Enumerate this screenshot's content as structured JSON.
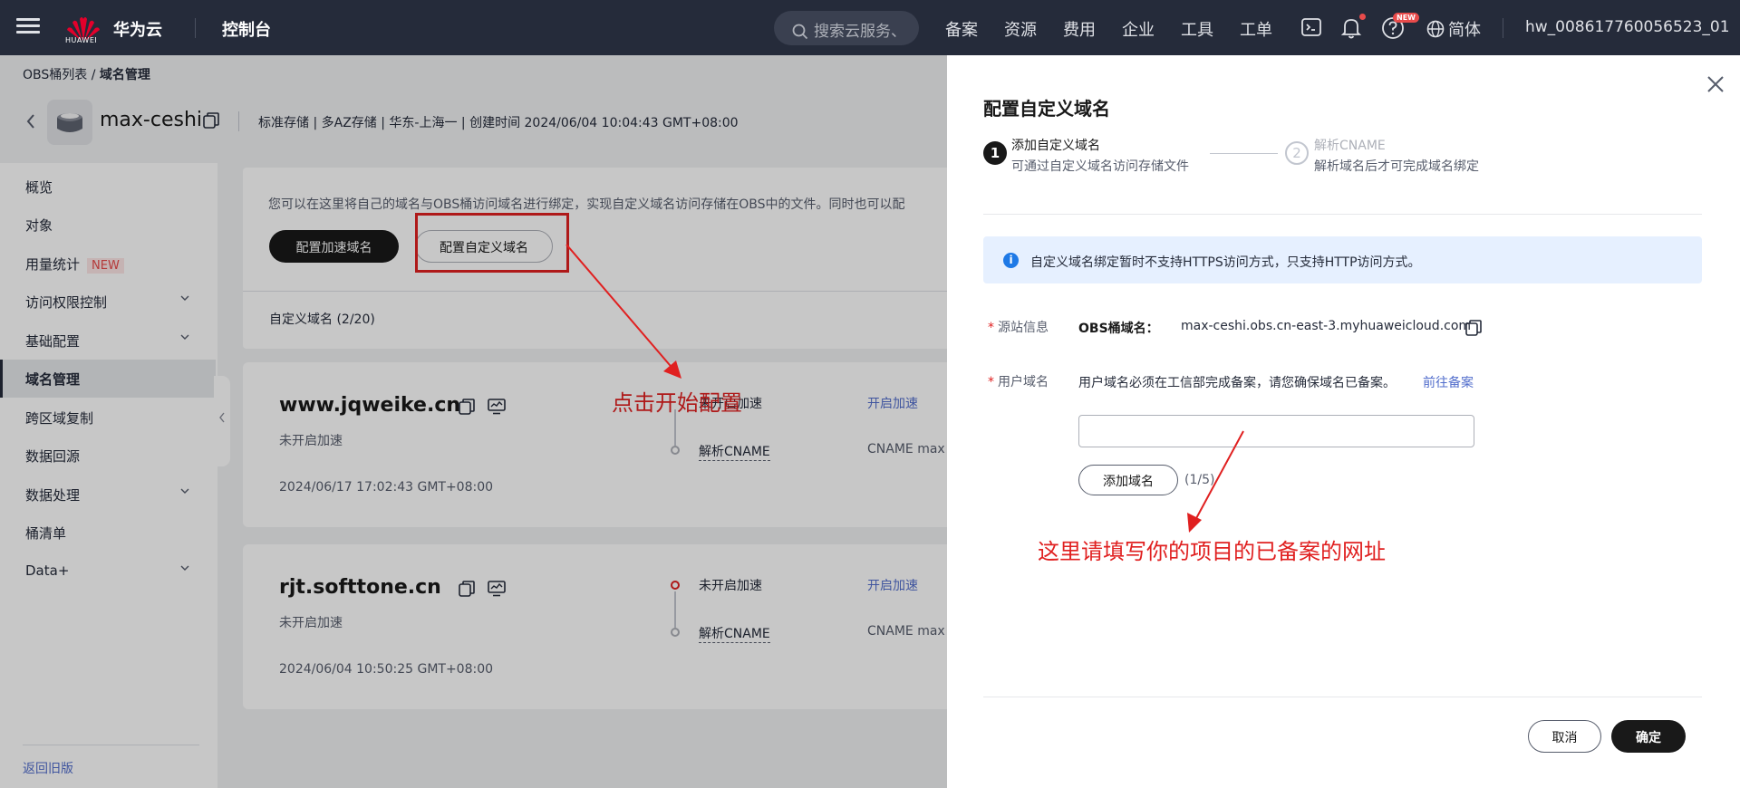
{
  "topbar": {
    "logo_text": "HUAWEI",
    "brand": "华为云",
    "console": "控制台",
    "search_placeholder": "搜索云服务、",
    "nav": [
      "备案",
      "资源",
      "费用",
      "企业",
      "工具",
      "工单"
    ],
    "new_badge": "NEW",
    "language": "简体",
    "user": "hw_008617760056523_01"
  },
  "breadcrumb": {
    "parent": "OBS桶列表",
    "current": "域名管理"
  },
  "bucket": {
    "name": "max-ceshi",
    "meta": "标准存储 | 多AZ存储 | 华东-上海一 | 创建时间  2024/06/04 10:04:43 GMT+08:00"
  },
  "sidebar": {
    "items": [
      {
        "label": "概览",
        "chev": false
      },
      {
        "label": "对象",
        "chev": false
      },
      {
        "label": "用量统计",
        "chev": false,
        "tag": "NEW"
      },
      {
        "label": "访问权限控制",
        "chev": true
      },
      {
        "label": "基础配置",
        "chev": true
      },
      {
        "label": "域名管理",
        "chev": false,
        "active": true
      },
      {
        "label": "跨区域复制",
        "chev": false
      },
      {
        "label": "数据回源",
        "chev": false
      },
      {
        "label": "数据处理",
        "chev": true
      },
      {
        "label": "桶清单",
        "chev": false
      },
      {
        "label": "Data+",
        "chev": true
      }
    ],
    "footer": "返回旧版"
  },
  "content": {
    "intro": "您可以在这里将自己的域名与OBS桶访问域名进行绑定，实现自定义域名访问存储在OBS中的文件。同时也可以配",
    "btn_accel": "配置加速域名",
    "btn_custom": "配置自定义域名",
    "list_header": "自定义域名  (2/20)"
  },
  "domains": [
    {
      "name": "www.jqweike.cn",
      "status": "未开启加速",
      "time": "2024/06/17 17:02:43 GMT+08:00",
      "step1": "未开启加速",
      "step2": "解析CNAME",
      "link": "开启加速",
      "cname": "CNAME  max"
    },
    {
      "name": "rjt.softtone.cn",
      "status": "未开启加速",
      "time": "2024/06/04 10:50:25 GMT+08:00",
      "step1": "未开启加速",
      "step2": "解析CNAME",
      "link": "开启加速",
      "cname": "CNAME  max"
    }
  ],
  "annotations": {
    "a1": "点击开始配置",
    "a2": "这里请填写你的项目的已备案的网址"
  },
  "drawer": {
    "title": "配置自定义域名",
    "step1": {
      "num": "1",
      "title": "添加自定义域名",
      "desc": "可通过自定义域名访问存储文件"
    },
    "step2": {
      "num": "2",
      "title": "解析CNAME",
      "desc": "解析域名后才可完成域名绑定"
    },
    "info_icon": "i",
    "info": "自定义域名绑定暂时不支持HTTPS访问方式，只支持HTTP访问方式。",
    "required_mark": "*",
    "source_label": "源站信息",
    "obs_label": "OBS桶域名：",
    "obs_value": "max-ceshi.obs.cn-east-3.myhuaweicloud.com",
    "user_label": "用户域名",
    "user_desc": "用户域名必须在工信部完成备案，请您确保域名已备案。",
    "user_link": "前往备案",
    "input_value": "",
    "add_btn": "添加域名",
    "add_count": "(1/5)",
    "cancel": "取消",
    "confirm": "确定"
  },
  "colors": {
    "topbar": "#252b3a",
    "accent": "#191919",
    "link": "#526ecc",
    "annotation": "#e02020"
  }
}
